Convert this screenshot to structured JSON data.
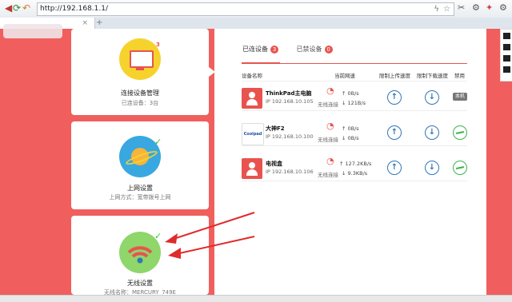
{
  "browser": {
    "url": "http://192.168.1.1/",
    "new_tab": "+",
    "tab_close": "×"
  },
  "cards": [
    {
      "title": "连接设备管理",
      "sub": "已连设备：3台",
      "badge": "3",
      "icon": "monitor-icon"
    },
    {
      "title": "上网设置",
      "sub": "上网方式：宽带拨号上网",
      "icon": "planet-icon"
    },
    {
      "title": "无线设置",
      "sub": "无线名称：MERCURY_749E",
      "icon": "wifi-icon"
    }
  ],
  "tabs": [
    {
      "label": "已连设备",
      "count": "3"
    },
    {
      "label": "已禁设备",
      "count": "0"
    }
  ],
  "columns": {
    "name": "设备名称",
    "speed": "当前网速",
    "up_limit": "限制上传速度",
    "down_limit": "限制下载速度",
    "disable": "禁用"
  },
  "devices": [
    {
      "name": "ThinkPad主电脑",
      "ip": "IP 192.168.10.105",
      "conn": "无线连接",
      "up": "0B/s",
      "down": "121B/s",
      "disable_badge": "本机",
      "avatar": "person-avatar"
    },
    {
      "name": "大神F2",
      "ip": "IP 192.168.10.100",
      "conn": "无线连接",
      "up": "0B/s",
      "down": "0B/s",
      "avatar": "Coolpad"
    },
    {
      "name": "电视盒",
      "ip": "IP 192.168.10.106",
      "conn": "无线连接",
      "up": "127.2KB/s",
      "down": "9.3KB/s",
      "avatar": "person-avatar"
    }
  ],
  "colors": {
    "accent": "#e8534f",
    "bg_red": "#f05f5d",
    "up_down_icon": "#2f76b8",
    "disable_icon": "#3bb54a"
  }
}
